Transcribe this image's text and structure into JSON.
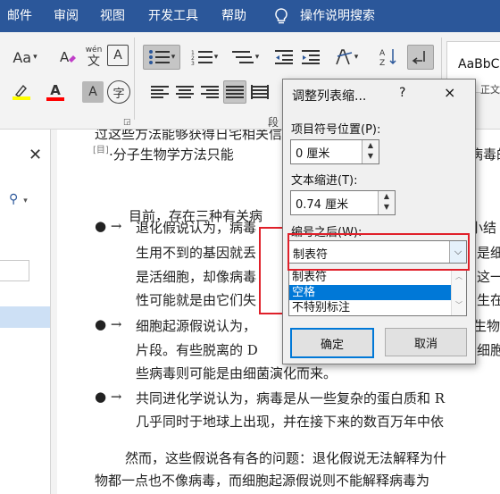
{
  "ribbon_tabs": [
    "邮件",
    "审阅",
    "视图",
    "开发工具",
    "帮助"
  ],
  "tell_me": "操作说明搜索",
  "ribbon": {
    "font_size_btn": "Aa",
    "wen_btn": "wén",
    "style_preview": "AaBbC",
    "paragraph_group_label": "段",
    "zheng_label": "正文"
  },
  "document": {
    "lines": [
      "过这些方法能够获得日宅相关信息,但对于",
      "·分子生物学方法只能",
      "病毒的",
      "目前，存在三种有关病",
      "退化假说认为，病毒",
      "小结",
      "生用不到的基因就丢",
      "是细",
      "是活细胞，却像病毒",
      "这一",
      "性可能就是由它们失",
      "生在",
      "细胞起源假说认为，",
      "生物",
      "片段。有些脱离的 D",
      "细胞",
      "些病毒则可能是由细菌演化而来。",
      "共同进化学说认为，病毒是从一些复杂的蛋白质和 R",
      "几乎同时于地球上出现，并在接下来的数百万年中依",
      "然而，这些假说各有各的问题：退化假说无法解释为什",
      "物都一点也不像病毒，而细胞起源假说则不能解释病毒为"
    ]
  },
  "dialog": {
    "title": "调整列表缩...",
    "help": "?",
    "close": "×",
    "number_position_label": "项目符号位置(P):",
    "number_position_value": "0 厘米",
    "text_indent_label": "文本缩进(T):",
    "text_indent_value": "0.74 厘米",
    "follow_number_label": "编号之后(W):",
    "follow_number_selected": "制表符",
    "options": [
      "制表符",
      "空格",
      "不特别标注"
    ],
    "highlighted_option": "空格",
    "ok": "确定",
    "cancel": "取消"
  },
  "colors": {
    "ribbon_blue": "#2b579a",
    "highlight_yellow": "#ffff00",
    "font_red": "#ff0000",
    "selection_blue": "#0078d7",
    "annotation_red": "#e0202a"
  }
}
